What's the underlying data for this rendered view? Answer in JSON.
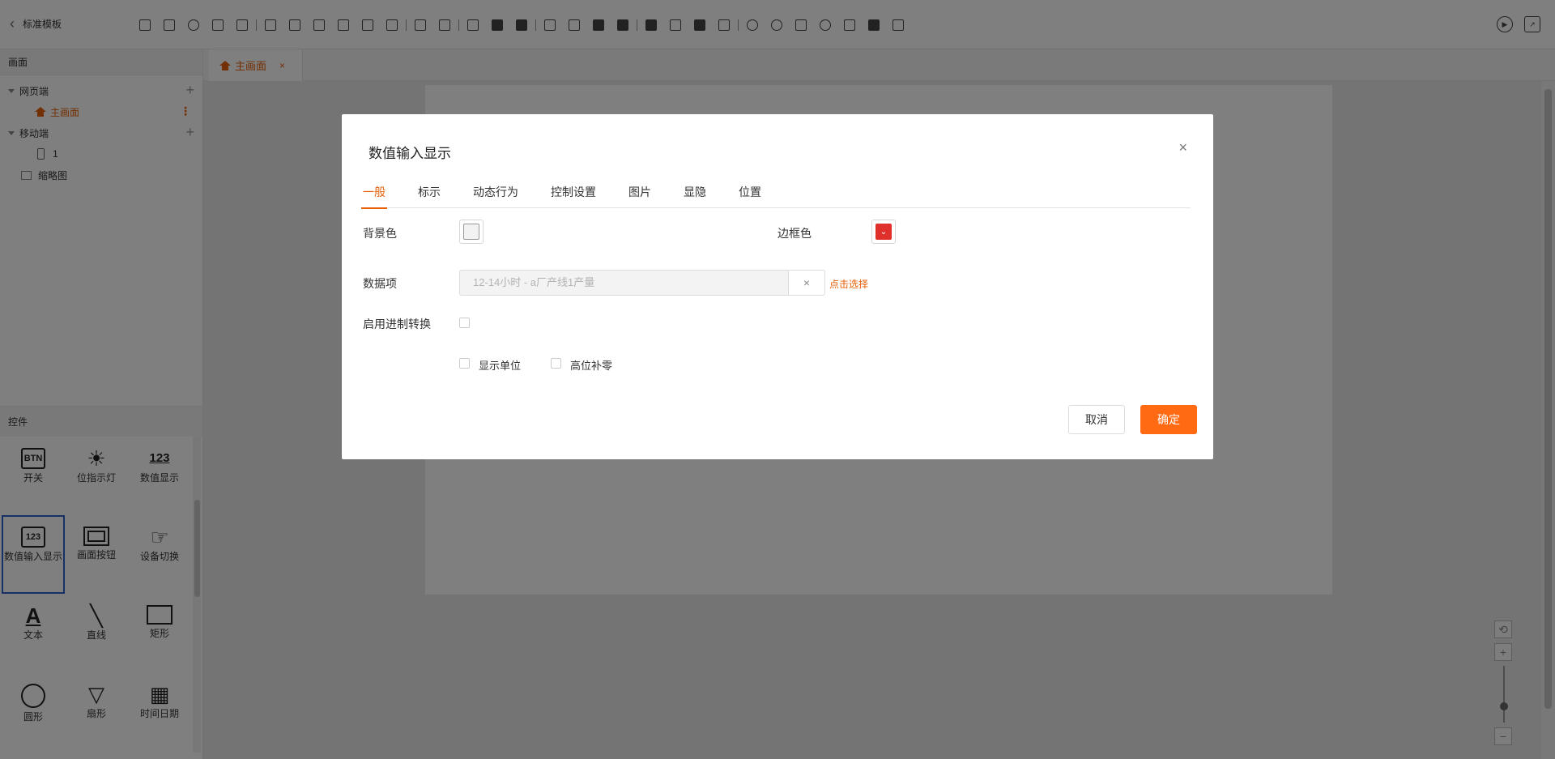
{
  "header": {
    "back_label": "标准模板"
  },
  "left_panel": {
    "screens_title": "画面",
    "tree": {
      "web_group": "网页端",
      "main_page": "主画面",
      "mobile_group": "移动端",
      "mobile_item": "1",
      "thumbnail": "缩略图"
    },
    "controls_title": "控件",
    "controls": [
      {
        "label": "开关",
        "icon_text": "BTN"
      },
      {
        "label": "位指示灯",
        "icon_text": "☀"
      },
      {
        "label": "数值显示",
        "icon_text": "123"
      },
      {
        "label": "数值输入显示",
        "icon_text": "123"
      },
      {
        "label": "画面按钮",
        "icon_text": ""
      },
      {
        "label": "设备切换",
        "icon_text": "☞"
      },
      {
        "label": "文本",
        "icon_text": "A"
      },
      {
        "label": "直线",
        "icon_text": "╲"
      },
      {
        "label": "矩形",
        "icon_text": ""
      },
      {
        "label": "圆形",
        "icon_text": ""
      },
      {
        "label": "扇形",
        "icon_text": "▽"
      },
      {
        "label": "时间日期",
        "icon_text": "▦"
      }
    ]
  },
  "tabbar": {
    "tab_label": "主画面",
    "close": "×"
  },
  "dialog": {
    "title": "数值输入显示",
    "close": "×",
    "tabs": [
      "一般",
      "标示",
      "动态行为",
      "控制设置",
      "图片",
      "显隐",
      "位置"
    ],
    "fields": {
      "bg_color_label": "背景色",
      "border_color_label": "边框色",
      "data_item_label": "数据项",
      "data_item_value": "12-14小时 - a厂产线1产量",
      "clear": "×",
      "pick_link": "点击选择",
      "radix_label": "启用进制转换",
      "show_unit_label": "显示单位",
      "zero_pad_label": "高位补零"
    },
    "buttons": {
      "cancel": "取消",
      "ok": "确定"
    },
    "colors": {
      "accent": "#e8600a",
      "confirm": "#ff6a13",
      "border_swatch": "#e0302b"
    }
  },
  "zoom": {
    "plus": "+",
    "minus": "−"
  }
}
